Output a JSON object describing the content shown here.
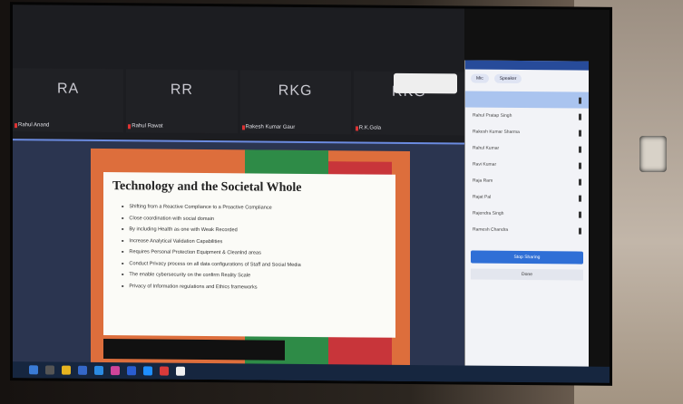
{
  "meeting": {
    "participants": [
      {
        "initials": "RA",
        "name": "Rahul Anand"
      },
      {
        "initials": "RR",
        "name": "Rahul Rawat"
      },
      {
        "initials": "RKG",
        "name": "Rakesh Kumar Gaur"
      },
      {
        "initials": "RKG",
        "name": "R.K.Gola"
      }
    ]
  },
  "slide": {
    "title": "Technology and the Societal Whole",
    "bullets": [
      "Shifting from a Reactive Compliance to a Proactive Compliance",
      "Close coordination with social domain",
      "By including Health as one with Weak Recorded",
      "Increase Analytical Validation Capabilities",
      "Requires Personal Protection Equipment & Cleanlnd areas",
      "Conduct Privacy process on all data configurations of Staff and Social Media",
      "The enable cybersecurity on the confirm Reality Scale",
      "Privacy of Information regulations and Ethics frameworks"
    ]
  },
  "panel": {
    "tabs": [
      "Mic",
      "Speaker"
    ],
    "participants": [
      "",
      "Rahul Pratap Singh",
      "Rakesh Kumar Sharma",
      "Rahul Kumar",
      "Ravi Kumar",
      "Raja Ram",
      "Rajat Pal",
      "Rajendra Singh",
      "Ramesh Chandra"
    ],
    "primary_button": "Stop Sharing",
    "secondary_button": "Done"
  }
}
